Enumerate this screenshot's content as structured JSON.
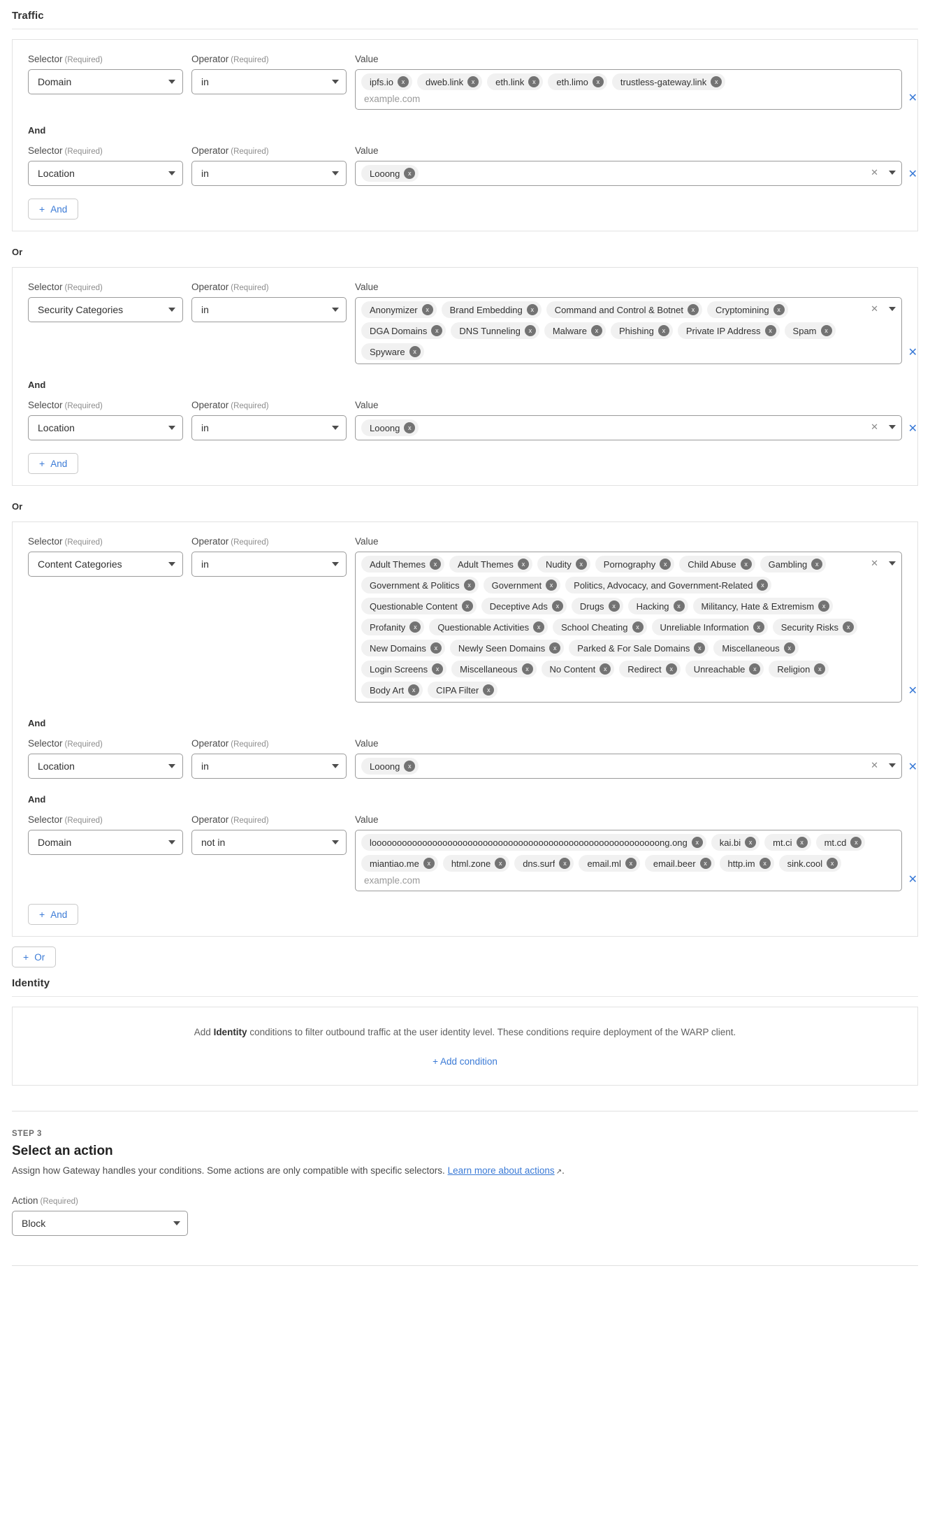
{
  "traffic": {
    "heading": "Traffic",
    "labels": {
      "selector": "Selector",
      "operator": "Operator",
      "value": "Value",
      "required": "(Required)",
      "and": "And",
      "or": "Or"
    },
    "domain_placeholder": "example.com",
    "add_and_label": "And",
    "add_or_label": "Or",
    "plus": "+",
    "remove_glyph": "✕",
    "clear_glyph": "✕",
    "chip_x": "x",
    "groups": [
      {
        "rows": [
          {
            "selector": "Domain",
            "operator": "in",
            "kind": "domain",
            "chips": [
              "ipfs.io",
              "dweb.link",
              "eth.link",
              "eth.limo",
              "trustless-gateway.link"
            ]
          },
          {
            "selector": "Location",
            "operator": "in",
            "kind": "select",
            "chips": [
              "Looong"
            ]
          }
        ]
      },
      {
        "rows": [
          {
            "selector": "Security Categories",
            "operator": "in",
            "kind": "select",
            "chips": [
              "Anonymizer",
              "Brand Embedding",
              "Command and Control & Botnet",
              "Cryptomining",
              "DGA Domains",
              "DNS Tunneling",
              "Malware",
              "Phishing",
              "Private IP Address",
              "Spam",
              "Spyware"
            ]
          },
          {
            "selector": "Location",
            "operator": "in",
            "kind": "select",
            "chips": [
              "Looong"
            ]
          }
        ]
      },
      {
        "rows": [
          {
            "selector": "Content Categories",
            "operator": "in",
            "kind": "select",
            "chips": [
              "Adult Themes",
              "Adult Themes",
              "Nudity",
              "Pornography",
              "Child Abuse",
              "Gambling",
              "Government & Politics",
              "Government",
              "Politics, Advocacy, and Government-Related",
              "Questionable Content",
              "Deceptive Ads",
              "Drugs",
              "Hacking",
              "Militancy, Hate & Extremism",
              "Profanity",
              "Questionable Activities",
              "School Cheating",
              "Unreliable Information",
              "Security Risks",
              "New Domains",
              "Newly Seen Domains",
              "Parked & For Sale Domains",
              "Miscellaneous",
              "Login Screens",
              "Miscellaneous",
              "No Content",
              "Redirect",
              "Unreachable",
              "Religion",
              "Body Art",
              "CIPA Filter"
            ]
          },
          {
            "selector": "Location",
            "operator": "in",
            "kind": "select",
            "chips": [
              "Looong"
            ]
          },
          {
            "selector": "Domain",
            "operator": "not in",
            "kind": "domain",
            "chips": [
              "looooooooooooooooooooooooooooooooooooooooooooooooooooooooong.ong",
              "kai.bi",
              "mt.ci",
              "mt.cd",
              "miantiao.me",
              "html.zone",
              "dns.surf",
              "email.ml",
              "email.beer",
              "http.im",
              "sink.cool"
            ]
          }
        ]
      }
    ]
  },
  "identity": {
    "heading": "Identity",
    "text_before": "Add ",
    "text_bold": "Identity",
    "text_after": " conditions to filter outbound traffic at the user identity level. These conditions require deployment of the WARP client.",
    "add_condition": "+ Add condition"
  },
  "step3": {
    "kicker": "STEP 3",
    "title": "Select an action",
    "desc": "Assign how Gateway handles your conditions. Some actions are only compatible with specific selectors.",
    "link": "Learn more about actions",
    "ext_icon": "↗",
    "desc_tail": ".",
    "action_label": "Action",
    "required": "(Required)",
    "action_value": "Block"
  },
  "colors": {
    "link": "#3a7ad6",
    "chip_bg": "#f1f1f1",
    "chip_x_bg": "#737373",
    "border": "#9b9b9b"
  }
}
